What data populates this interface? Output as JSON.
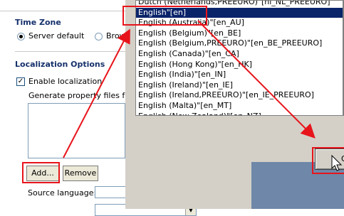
{
  "timezone": {
    "header": "Time Zone",
    "server_default": "Server default",
    "browser": "Browse"
  },
  "localization": {
    "header": "Localization Options",
    "enable_label": "Enable localization",
    "enable_checked": true,
    "generate_label": "Generate property files for th",
    "add_label": "Add...",
    "remove_label": "Remove",
    "source_language_label": "Source language:"
  },
  "dialog": {
    "locales": [
      "Dutch (Netherlands,PREEURO)\"[nl_NL_PREEURO]",
      "English\"[en]",
      "English (Australia)\"[en_AU]",
      "English (Belgium)\"[en_BE]",
      "English (Belgium,PREEURO)\"[en_BE_PREEURO]",
      "English (Canada)\"[en_CA]",
      "English (Hong Kong)\"[en_HK]",
      "English (India)\"[en_IN]",
      "English (Ireland)\"[en_IE]",
      "English (Ireland,PREEURO)\"[en_IE_PREEURO]",
      "English (Malta)\"[en_MT]",
      "English (New Zealand)\"[en_NZ]"
    ],
    "selected_index": 1,
    "ok_label": "O"
  },
  "annotation_color": "#e8141b"
}
